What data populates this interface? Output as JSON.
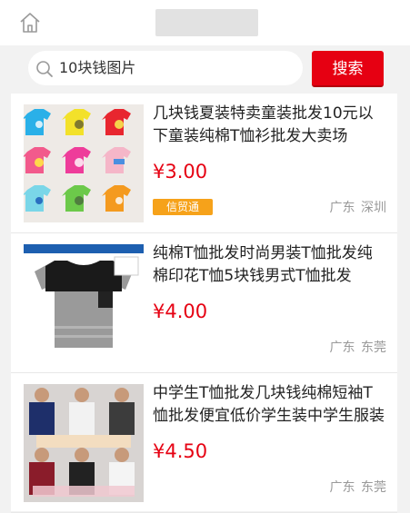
{
  "search": {
    "query": "10块钱图片",
    "button_label": "搜索"
  },
  "products": [
    {
      "title": "几块钱夏装特卖童装批发10元以下童装纯棉T恤衫批发大卖场",
      "price": "¥3.00",
      "badge": "信贸通",
      "province": "广东",
      "city": "深圳"
    },
    {
      "title": "纯棉T恤批发时尚男装T恤批发纯棉印花T恤5块钱男式T恤批发",
      "price": "¥4.00",
      "province": "广东",
      "city": "东莞"
    },
    {
      "title": "中学生T恤批发几块钱纯棉短袖T恤批发便宜低价学生装中学生服装",
      "price": "¥4.50",
      "province": "广东",
      "city": "东莞"
    }
  ],
  "colors": {
    "accent": "#e60012",
    "badge": "#f6a21a"
  }
}
